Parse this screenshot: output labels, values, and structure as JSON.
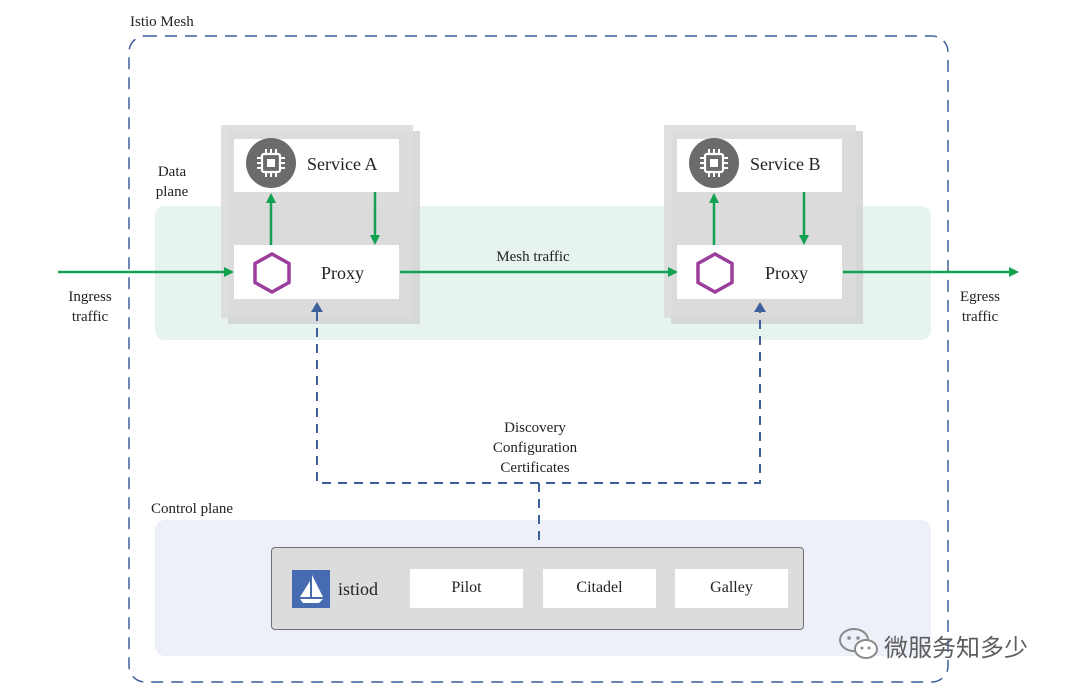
{
  "mesh": {
    "title": "Istio Mesh"
  },
  "data_plane": {
    "label_line1": "Data",
    "label_line2": "plane"
  },
  "control_plane": {
    "label": "Control plane"
  },
  "services": [
    {
      "name": "Service A",
      "proxy": "Proxy"
    },
    {
      "name": "Service B",
      "proxy": "Proxy"
    }
  ],
  "traffic": {
    "ingress_line1": "Ingress",
    "ingress_line2": "traffic",
    "egress_line1": "Egress",
    "egress_line2": "traffic",
    "mesh": "Mesh traffic"
  },
  "config": {
    "line1": "Discovery",
    "line2": "Configuration",
    "line3": "Certificates"
  },
  "istiod": {
    "name": "istiod",
    "components": [
      "Pilot",
      "Citadel",
      "Galley"
    ]
  },
  "watermark": {
    "text": "微服务知多少"
  },
  "colors": {
    "arrow_green": "#13a152",
    "dash_blue": "#3d5f9c",
    "hexagon_purple": "#9b3d9c",
    "data_plane_bg": "#e6f3ee",
    "control_plane_bg": "#edf0f8",
    "pod_gray": "#dcdcdc"
  },
  "icons": {
    "service": "cpu-chip-icon",
    "proxy": "hexagon-icon",
    "istio": "istio-sail-logo",
    "wechat": "wechat-icon"
  }
}
